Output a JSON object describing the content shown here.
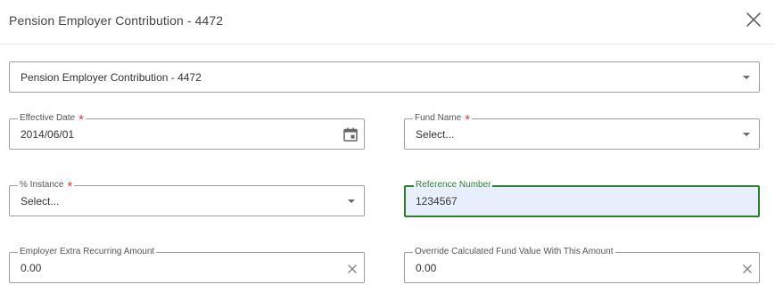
{
  "dialog": {
    "title": "Pension Employer Contribution - 4472"
  },
  "selector": {
    "value": "Pension Employer Contribution - 4472"
  },
  "fields": {
    "effective_date": {
      "label": "Effective Date",
      "required_mark": "*",
      "value": "2014/06/01"
    },
    "fund_name": {
      "label": "Fund Name",
      "required_mark": "*",
      "value": "Select..."
    },
    "instance": {
      "label": "% Instance",
      "required_mark": "*",
      "value": "Select..."
    },
    "reference_number": {
      "label": "Reference Number",
      "value": "1234567"
    },
    "employer_extra": {
      "label": "Employer Extra Recurring Amount",
      "value": "0.00"
    },
    "override_fund": {
      "label": "Override Calculated Fund Value With This Amount",
      "value": "0.00"
    }
  },
  "colors": {
    "focus_border": "#2e7d32",
    "focus_background": "#e8effc",
    "required": "#e53935"
  },
  "icons": [
    "close-icon",
    "calendar-icon",
    "chevron-down-icon",
    "clear-icon"
  ]
}
